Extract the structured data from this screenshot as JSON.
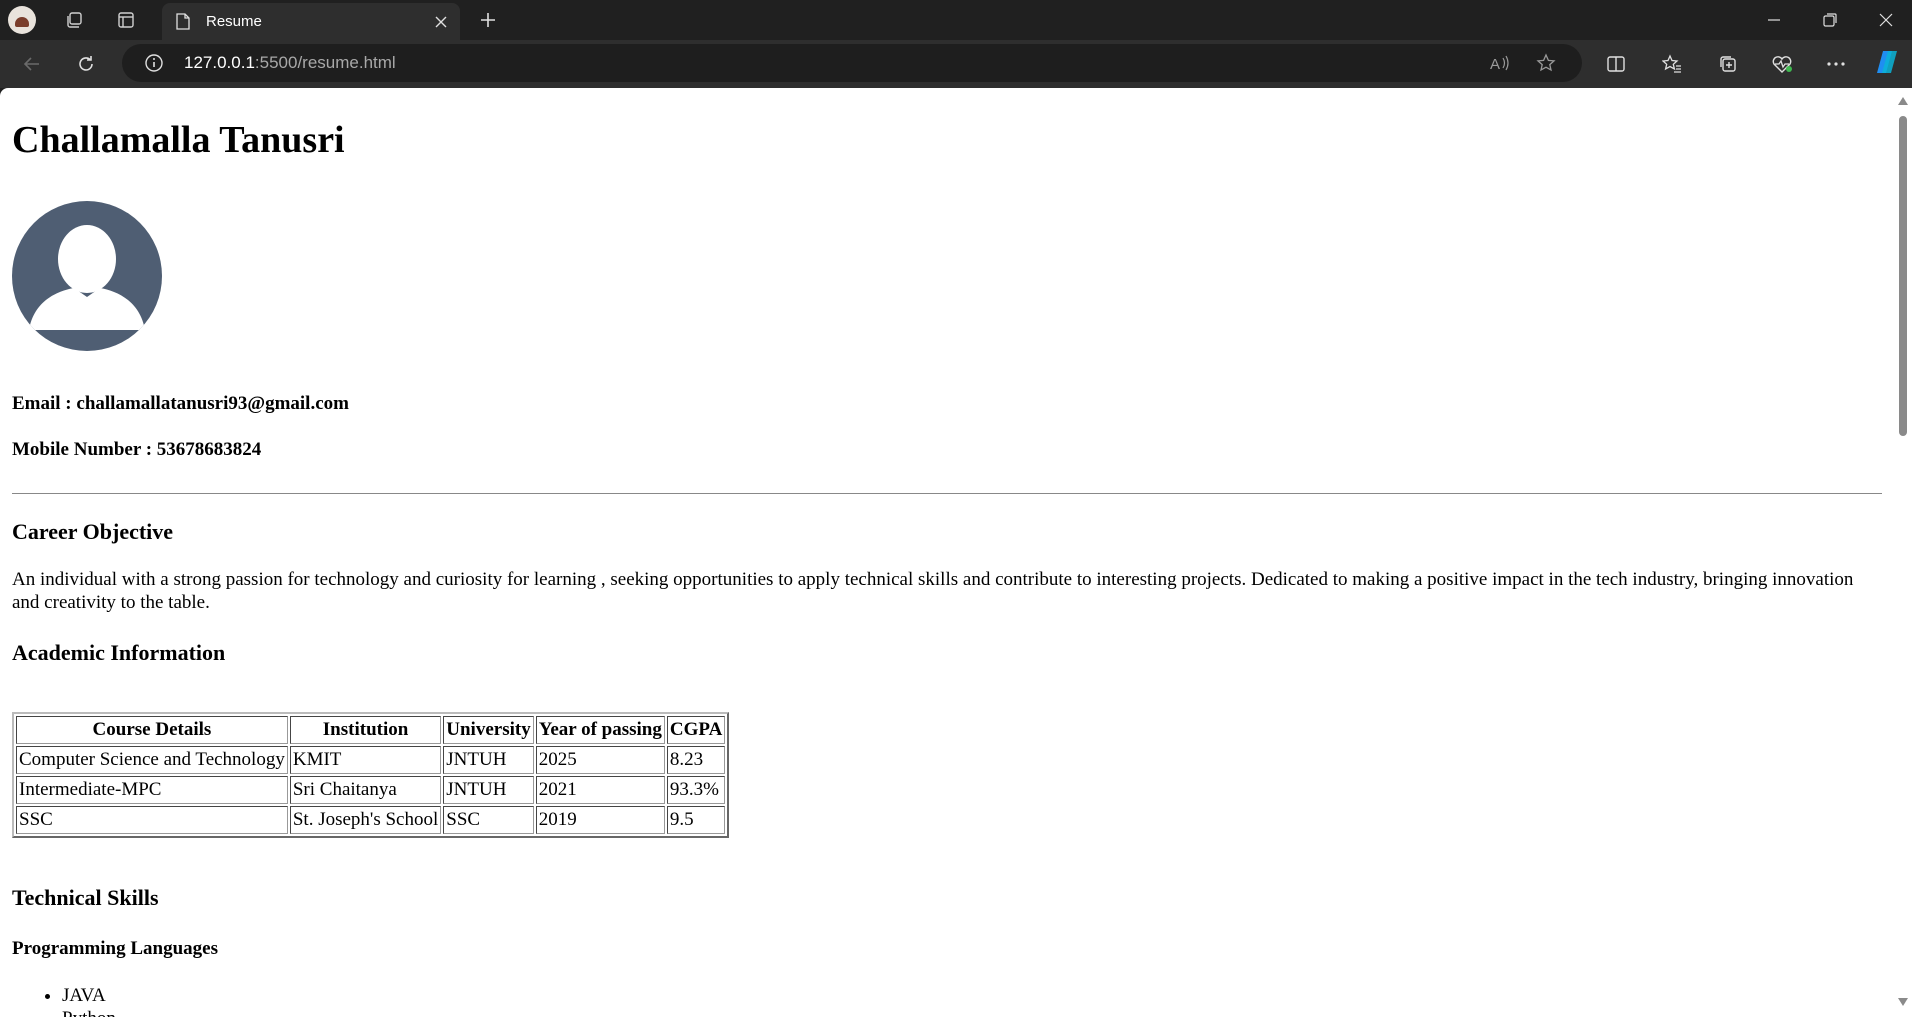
{
  "browser": {
    "tab_title": "Resume",
    "url_host": "127.0.0.1",
    "url_rest": ":5500/resume.html"
  },
  "resume": {
    "name": "Challamalla Tanusri",
    "email_label": "Email : challamallatanusri93@gmail.com",
    "mobile_label": "Mobile Number : 53678683824",
    "career_heading": "Career Objective",
    "career_text": "An individual with a strong passion for technology and curiosity for learning , seeking opportunities to apply technical skills and contribute to interesting projects. Dedicated to making a positive impact in the tech industry, bringing innovation and creativity to the table.",
    "academic_heading": "Academic Information",
    "table": {
      "headers": [
        "Course Details",
        "Institution",
        "University",
        "Year of passing",
        "CGPA"
      ],
      "rows": [
        [
          "Computer Science and Technology",
          "KMIT",
          "JNTUH",
          "2025",
          "8.23"
        ],
        [
          "Intermediate-MPC",
          "Sri Chaitanya",
          "JNTUH",
          "2021",
          "93.3%"
        ],
        [
          "SSC",
          "St. Joseph's School",
          "SSC",
          "2019",
          "9.5"
        ]
      ]
    },
    "skills_heading": "Technical Skills",
    "programming_heading": "Programming Languages",
    "languages": [
      "JAVA",
      "Python"
    ]
  }
}
